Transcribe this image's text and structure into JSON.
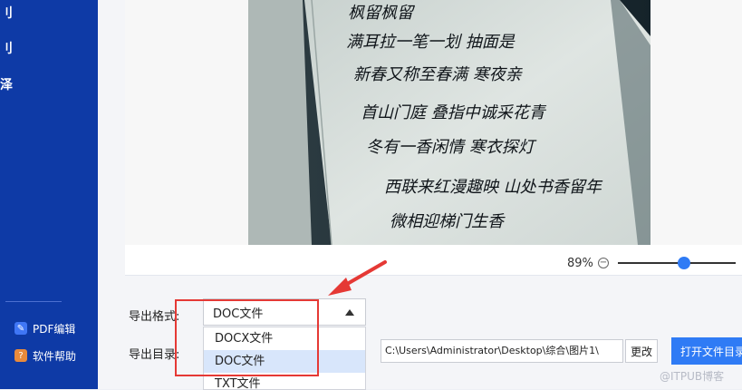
{
  "sidebar": {
    "nav_glyphs": [
      "刂",
      "刂",
      "泽"
    ],
    "links": [
      {
        "label": "PDF编辑",
        "icon": "pdf-edit-icon"
      },
      {
        "label": "软件帮助",
        "icon": "help-icon"
      }
    ]
  },
  "preview": {
    "zoom_label": "89%",
    "zoom_level_percent": 89,
    "calligraphy_lines": [
      "枫留枫留",
      "满耳拉一笔一划  抽面是",
      "新春又称至春满  寒夜亲",
      "首山门庭  叠指中诚采花青",
      "冬有一香闲情  寒衣探灯",
      "西联来红漫趣映  山处书香留年",
      "微相迎梯门生香"
    ]
  },
  "form": {
    "format_label": "导出格式:",
    "selected_format": "DOC文件",
    "options": [
      "DOCX文件",
      "DOC文件",
      "TXT文件"
    ],
    "dir_label": "导出目录:",
    "dir_value": "C:\\Users\\Administrator\\Desktop\\综合\\图片1\\",
    "change_label": "更改",
    "open_dir_label": "打开文件目录"
  },
  "watermark": "@ITPUB博客",
  "colors": {
    "sidebar": "#0e3aa6",
    "accent": "#2f7bf5",
    "highlight": "#e53935"
  }
}
